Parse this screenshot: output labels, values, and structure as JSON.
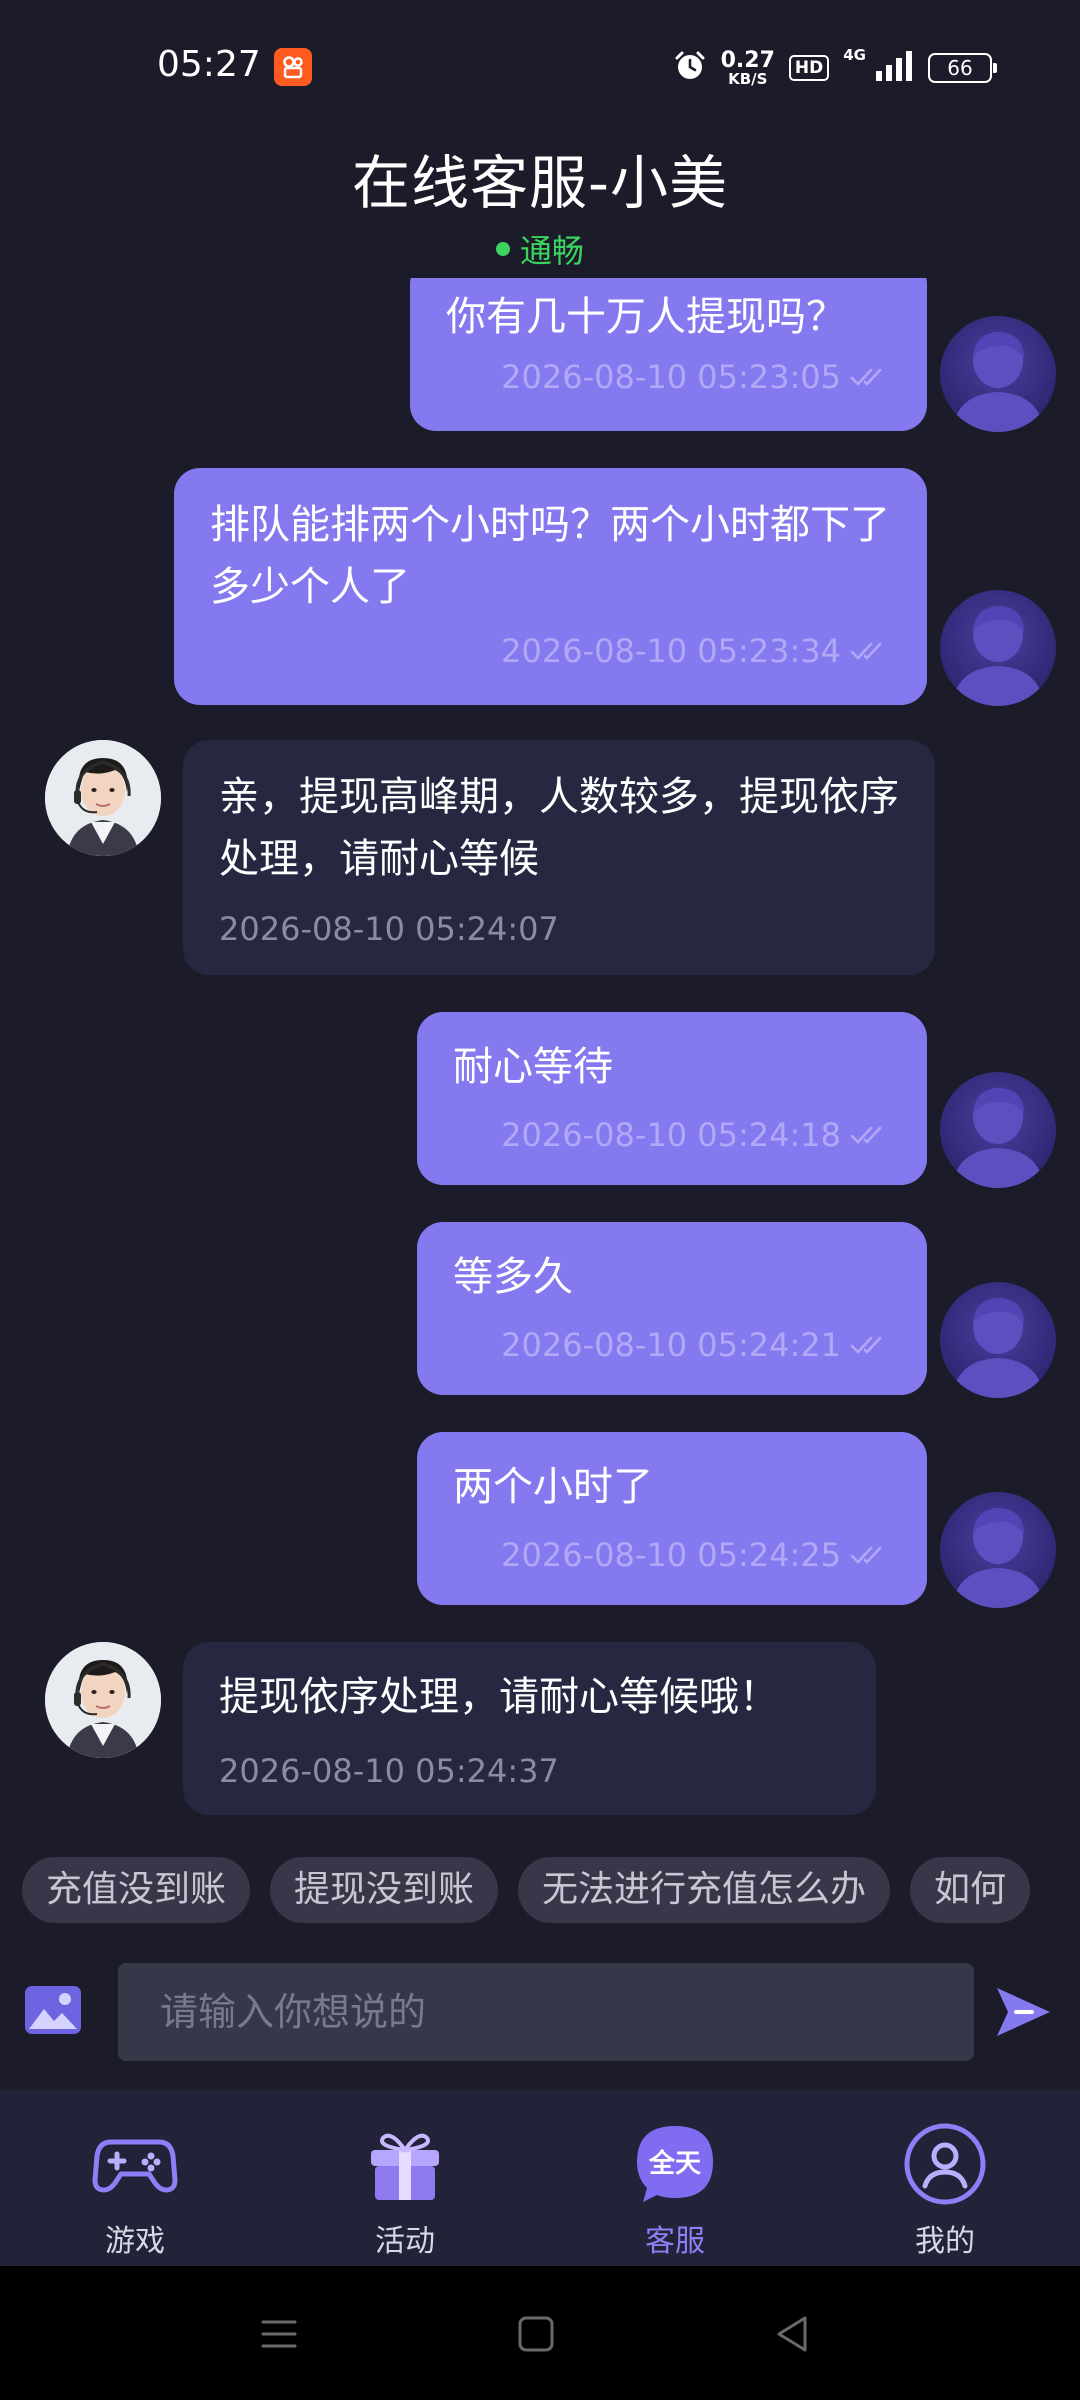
{
  "status_bar": {
    "time": "05:27",
    "net_speed_value": "0.27",
    "net_speed_unit": "KB/S",
    "hd_label": "HD",
    "network_type": "4G",
    "battery": "66"
  },
  "header": {
    "title": "在线客服-小美",
    "connection_status": "通畅",
    "status_color": "#3ad45e"
  },
  "messages": [
    {
      "sender": "me",
      "text": "你有几十万人提现吗？",
      "time": "2026-08-10 05:23:05"
    },
    {
      "sender": "me",
      "text": "排队能排两个小时吗？两个小时都下了多少个人了",
      "time": "2026-08-10 05:23:34"
    },
    {
      "sender": "agent",
      "text": "亲，提现高峰期，人数较多，提现依序处理，请耐心等候",
      "time": "2026-08-10 05:24:07"
    },
    {
      "sender": "me",
      "text": "耐心等待",
      "time": "2026-08-10 05:24:18"
    },
    {
      "sender": "me",
      "text": "等多久",
      "time": "2026-08-10 05:24:21"
    },
    {
      "sender": "me",
      "text": "两个小时了",
      "time": "2026-08-10 05:24:25"
    },
    {
      "sender": "agent",
      "text": "提现依序处理，请耐心等候哦！",
      "time": "2026-08-10 05:24:37"
    }
  ],
  "quick_replies": [
    "充值没到账",
    "提现没到账",
    "无法进行充值怎么办",
    "如何"
  ],
  "input": {
    "placeholder": "请输入你想说的"
  },
  "bottom_nav": [
    {
      "label": "游戏",
      "icon": "gamepad-icon"
    },
    {
      "label": "活动",
      "icon": "gift-icon"
    },
    {
      "label": "客服",
      "icon": "customer-service-icon",
      "badge_text": "全天",
      "active": true
    },
    {
      "label": "我的",
      "icon": "profile-icon"
    }
  ],
  "colors": {
    "background": "#1c1b29",
    "user_bubble": "#8579f0",
    "agent_bubble": "#262841",
    "accent": "#8d7ff5"
  }
}
